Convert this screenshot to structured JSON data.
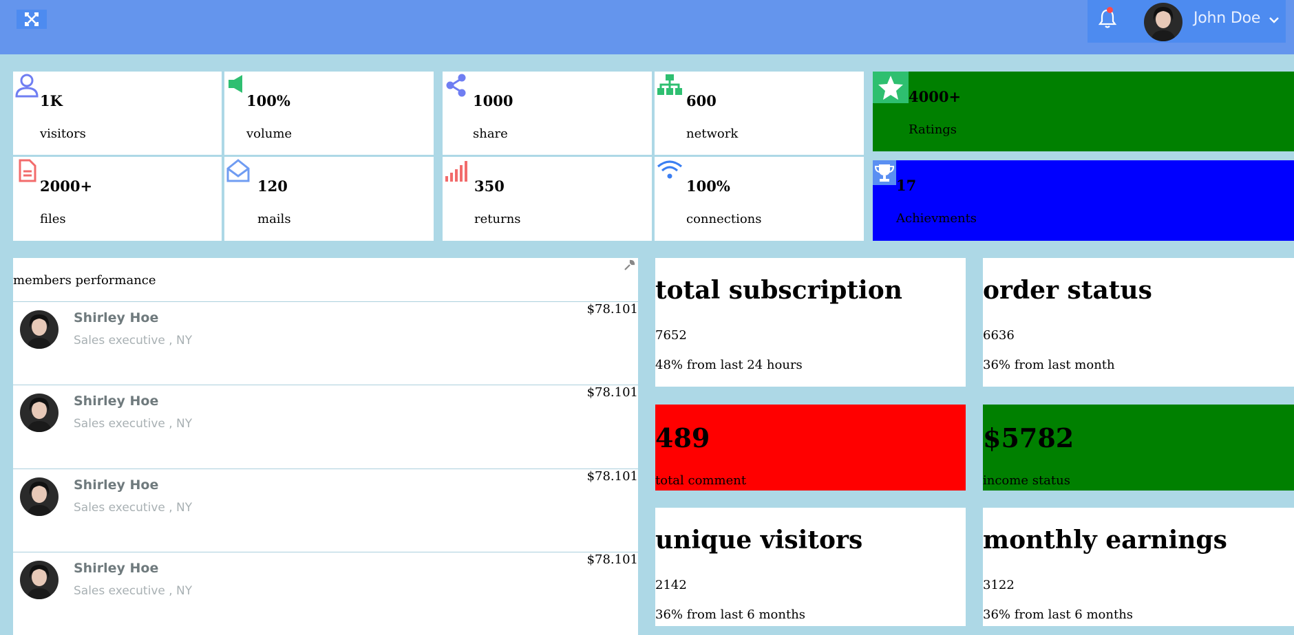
{
  "header": {
    "user_name": "John Doe",
    "colors": {
      "bar": "#6495ed",
      "user_box": "#4d8bf0",
      "notification_dot": "#ff4b4b"
    },
    "icons": [
      "expand-icon",
      "bell-icon",
      "chevron-down-icon"
    ]
  },
  "stats": [
    {
      "value": "1K",
      "label": "visitors",
      "icon": "user-icon",
      "color": "#6f7ef2"
    },
    {
      "value": "100%",
      "label": "volume",
      "icon": "megaphone-icon",
      "color": "#2fbf71"
    },
    {
      "value": "1000",
      "label": "share",
      "icon": "share-icon",
      "color": "#6f7ef2"
    },
    {
      "value": "600",
      "label": "network",
      "icon": "sitemap-icon",
      "color": "#2fbf71"
    },
    {
      "value": "2000+",
      "label": "files",
      "icon": "file-icon",
      "color": "#f26b6b"
    },
    {
      "value": "120",
      "label": "mails",
      "icon": "envelope-open-icon",
      "color": "#6f9cf2"
    },
    {
      "value": "350",
      "label": "returns",
      "icon": "signal-bars-icon",
      "color": "#f26b6b"
    },
    {
      "value": "100%",
      "label": "connections",
      "icon": "wifi-icon",
      "color": "#3b7ff2"
    }
  ],
  "wide_cards": [
    {
      "value": "4000+",
      "label": "Ratings",
      "icon": "star-icon",
      "bg": "#008000",
      "icon_bg": "#2ebf6f"
    },
    {
      "value": "17",
      "label": "Achievments",
      "icon": "trophy-icon",
      "bg": "#0000ff",
      "icon_bg": "#5a8ff2"
    }
  ],
  "members": {
    "title": "members performance",
    "rows": [
      {
        "name": "Shirley Hoe",
        "role": "Sales executive , NY",
        "amount": "$78.101"
      },
      {
        "name": "Shirley Hoe",
        "role": "Sales executive , NY",
        "amount": "$78.101"
      },
      {
        "name": "Shirley Hoe",
        "role": "Sales executive , NY",
        "amount": "$78.101"
      },
      {
        "name": "Shirley Hoe",
        "role": "Sales executive , NY",
        "amount": "$78.101"
      }
    ]
  },
  "info_cards": {
    "subscription": {
      "title": "total subscription",
      "value": "7652",
      "sub": "48% from last 24 hours"
    },
    "order": {
      "title": "order status",
      "value": "6636",
      "sub": "36% from last month"
    },
    "visitors": {
      "title": "unique visitors",
      "value": "2142",
      "sub": "36% from last 6 months"
    },
    "earnings": {
      "title": "monthly earnings",
      "value": "3122",
      "sub": "36% from last 6 months"
    }
  },
  "big_cards": {
    "comment": {
      "value": "489",
      "label": "total comment",
      "bg": "#ff0000"
    },
    "income": {
      "value": "$5782",
      "label": "income status",
      "bg": "#008000"
    }
  }
}
